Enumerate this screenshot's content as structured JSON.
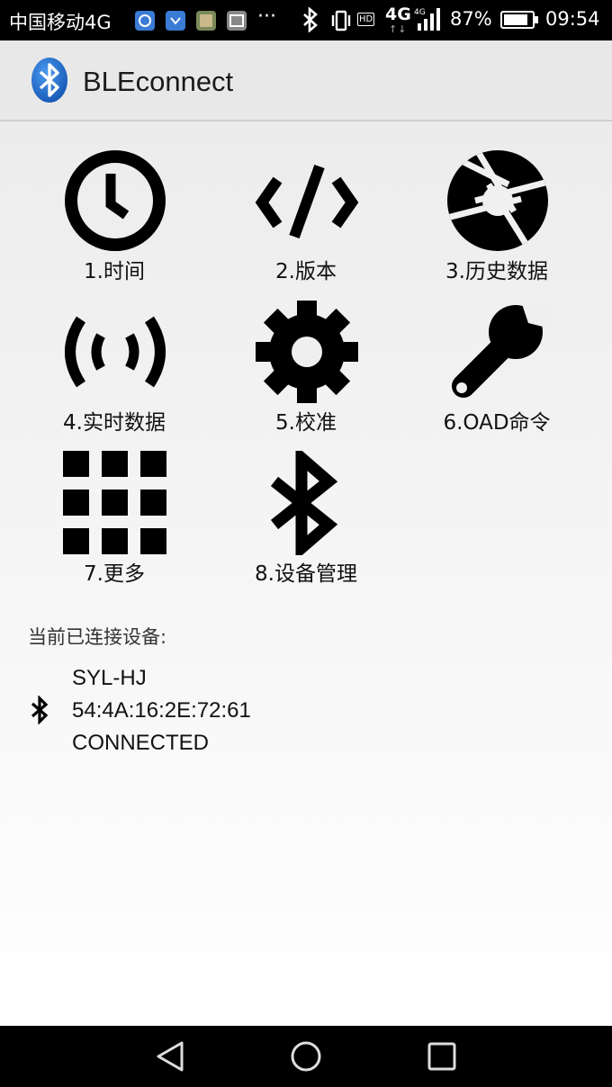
{
  "status_bar": {
    "carrier": "中国移动4G",
    "more_indicator": "···",
    "hd_label": "HD",
    "network": "4G",
    "network_small": "4G",
    "battery": "87%",
    "battery_level": 0.87,
    "time": "09:54",
    "notification_icons": [
      "qq-icon",
      "notify-icon",
      "photo-thumbnail-icon",
      "gallery-icon"
    ]
  },
  "action_bar": {
    "title": "BLEconnect",
    "logo_icon": "bluetooth-logo-icon",
    "logo_color": "#1f6fd1"
  },
  "menu": [
    {
      "label": "1.时间",
      "icon": "clock-icon"
    },
    {
      "label": "2.版本",
      "icon": "code-icon"
    },
    {
      "label": "3.历史数据",
      "icon": "aperture-icon"
    },
    {
      "label": "4.实时数据",
      "icon": "broadcast-icon"
    },
    {
      "label": "5.校准",
      "icon": "gear-icon"
    },
    {
      "label": "6.OAD命令",
      "icon": "wrench-icon"
    },
    {
      "label": "7.更多",
      "icon": "grid-icon"
    },
    {
      "label": "8.设备管理",
      "icon": "bluetooth-icon"
    }
  ],
  "connection": {
    "title": "当前已连接设备:",
    "device_name": "SYL-HJ",
    "address": "54:4A:16:2E:72:61",
    "status": "CONNECTED"
  },
  "nav_bar": {
    "back_icon": "back-triangle-icon",
    "home_icon": "home-circle-icon",
    "recents_icon": "recents-square-icon"
  }
}
